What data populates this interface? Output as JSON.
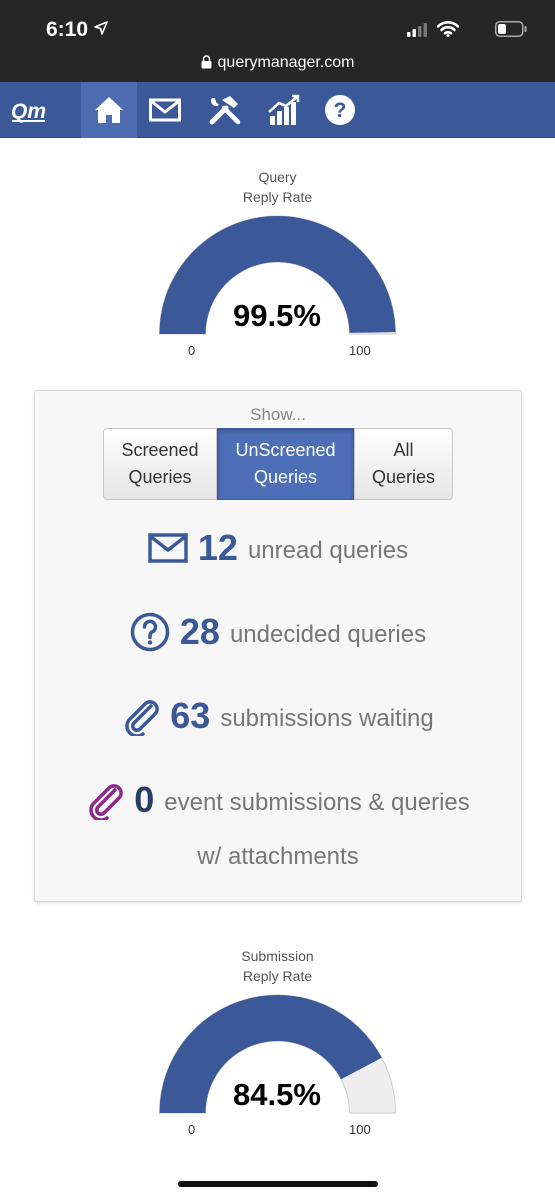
{
  "status_bar": {
    "time": "6:10",
    "url": "querymanager.com"
  },
  "nav": {
    "logo": "Qm",
    "items": [
      {
        "icon": "home-icon",
        "active": true
      },
      {
        "icon": "mail-icon",
        "active": false
      },
      {
        "icon": "tools-icon",
        "active": false
      },
      {
        "icon": "chart-icon",
        "active": false
      },
      {
        "icon": "help-icon",
        "active": false
      }
    ]
  },
  "query_gauge": {
    "title_line1": "Query",
    "title_line2": "Reply Rate",
    "value_label": "99.5%",
    "value": 99.5,
    "min": "0",
    "max": "100",
    "fill_color": "#3b5998",
    "track_color": "#eeeeee"
  },
  "panel": {
    "show_label": "Show...",
    "filters": [
      {
        "line1": "Screened",
        "line2": "Queries",
        "selected": false
      },
      {
        "line1": "UnScreened",
        "line2": "Queries",
        "selected": true
      },
      {
        "line1": "All",
        "line2": "Queries",
        "selected": false
      }
    ],
    "stats": {
      "unread": {
        "count": "12",
        "label": "unread queries"
      },
      "undecided": {
        "count": "28",
        "label": "undecided queries"
      },
      "submissions": {
        "count": "63",
        "label": "submissions waiting"
      },
      "events": {
        "count": "0",
        "label_line1": "event submissions & queries",
        "label_line2": "w/ attachments"
      }
    }
  },
  "submission_gauge": {
    "title_line1": "Submission",
    "title_line2": "Reply Rate",
    "value_label": "84.5%",
    "value": 84.5,
    "min": "0",
    "max": "100",
    "fill_color": "#3b5998",
    "track_color": "#eeeeee"
  },
  "colors": {
    "brand": "#3b5998",
    "nav_active": "#4c6bb0",
    "attachment_purple": "#8b2a8b"
  }
}
